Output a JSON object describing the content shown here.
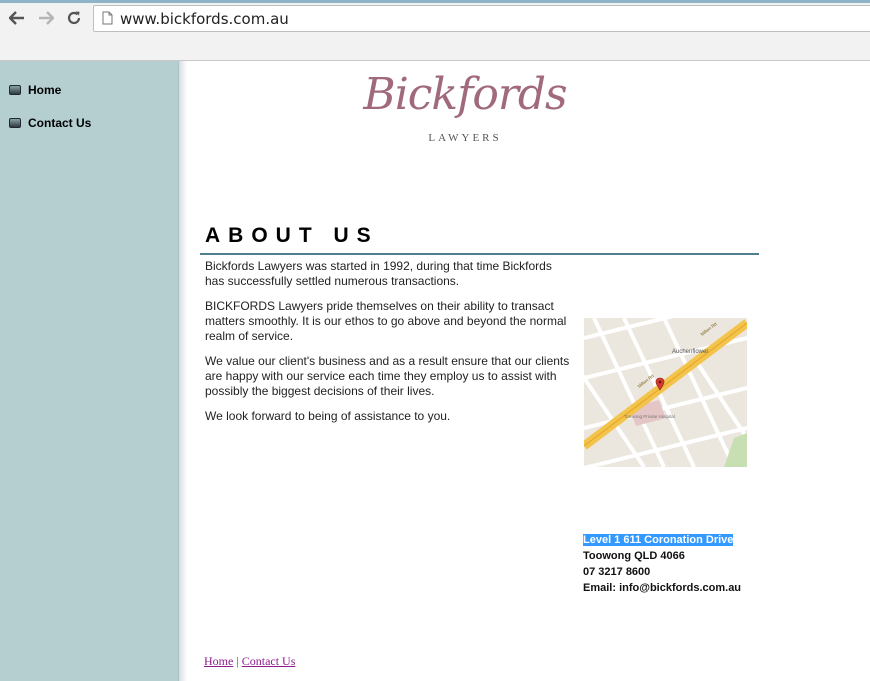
{
  "browser": {
    "url": "www.bickfords.com.au"
  },
  "sidebar": {
    "items": [
      {
        "label": "Home"
      },
      {
        "label": "Contact Us"
      }
    ]
  },
  "logo": {
    "name": "Bickfords",
    "subtitle": "LAWYERS"
  },
  "about": {
    "title": "ABOUT US",
    "paragraphs": [
      "Bickfords Lawyers was started in 1992, during that time Bickfords has successfully settled numerous transactions.",
      "BICKFORDS Lawyers pride themselves on their ability to transact matters smoothly.  It is our ethos to go above and beyond the normal realm of service.",
      "We value our client's business and as a result ensure that our clients are happy with our service each time they employ us to assist with possibly the biggest decisions of their lives.",
      "We look forward to being of assistance to you."
    ]
  },
  "map": {
    "labels": [
      "Milton Rd",
      "Auchenflower",
      "Toowong Private Hospital"
    ]
  },
  "address": {
    "line1": "Level 1 611 Coronation Drive",
    "line2": "Toowong QLD 4066",
    "phone": "07 3217 8600",
    "email": "Email: info@bickfords.com.au"
  },
  "footer": {
    "home": "Home",
    "separator": " | ",
    "contact": "Contact Us"
  }
}
